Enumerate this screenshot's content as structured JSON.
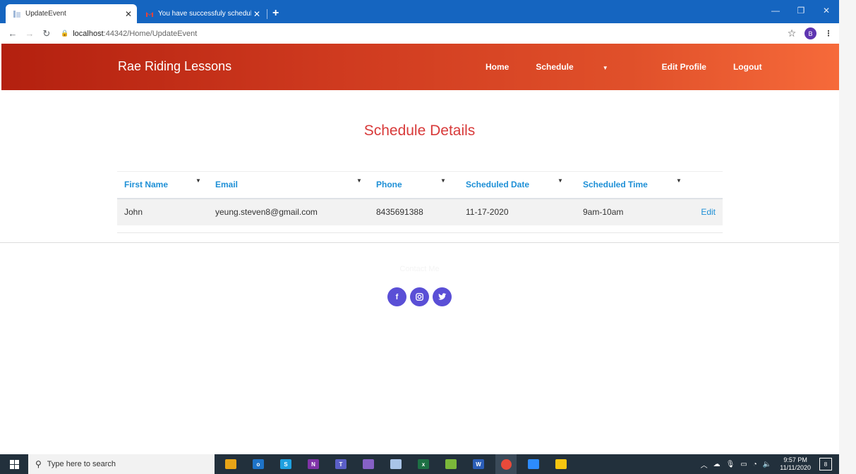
{
  "browser": {
    "tabs": [
      {
        "title": "UpdateEvent",
        "active": true
      },
      {
        "title": "You have successfuly scheduled t",
        "active": false
      }
    ],
    "new_tab_label": "+",
    "url_host": "localhost",
    "url_path": ":44342/Home/UpdateEvent",
    "profile_initial": "B"
  },
  "site": {
    "brand": "Rae Riding Lessons",
    "nav": {
      "home": "Home",
      "schedule": "Schedule",
      "edit_profile": "Edit Profile",
      "logout": "Logout"
    },
    "accent_color": "#d83a3a",
    "link_color": "#1d8fd6"
  },
  "main": {
    "heading": "Schedule Details",
    "table": {
      "columns": [
        "First Name",
        "Email",
        "Phone",
        "Scheduled Date",
        "Scheduled Time"
      ],
      "rows": [
        {
          "first_name": "John",
          "email": "yeung.steven8@gmail.com",
          "phone": "8435691388",
          "date": "11-17-2020",
          "time": "9am-10am",
          "action": "Edit"
        }
      ]
    }
  },
  "footer": {
    "contact_label": "Contact Me",
    "socials": [
      {
        "icon": "facebook-icon",
        "glyph": "f"
      },
      {
        "icon": "instagram-icon",
        "glyph": "◙"
      },
      {
        "icon": "twitter-icon",
        "glyph": "✦"
      }
    ]
  },
  "taskbar": {
    "search_placeholder": "Type here to search",
    "time": "9:57 PM",
    "date": "11/11/2020",
    "notification_count": "8",
    "apps": [
      {
        "name": "file-explorer-icon",
        "label": "",
        "color": "#e8a417"
      },
      {
        "name": "outlook-icon",
        "label": "o",
        "color": "#1e73c8"
      },
      {
        "name": "skype-icon",
        "label": "S",
        "color": "#1ea0e0"
      },
      {
        "name": "onenote-icon",
        "label": "N",
        "color": "#8033a8"
      },
      {
        "name": "teams-icon",
        "label": "T",
        "color": "#5b5fc7"
      },
      {
        "name": "visual-studio-icon",
        "label": "",
        "color": "#8661c5"
      },
      {
        "name": "powershell-icon",
        "label": "",
        "color": "#a9c4e8"
      },
      {
        "name": "excel-icon",
        "label": "x",
        "color": "#1d7044"
      },
      {
        "name": "project-icon",
        "label": "",
        "color": "#7bb83a"
      },
      {
        "name": "word-icon",
        "label": "W",
        "color": "#2b5eb8"
      },
      {
        "name": "chrome-icon",
        "label": "",
        "color": "#e84a3a"
      },
      {
        "name": "zoom-icon",
        "label": "",
        "color": "#2d8cff"
      },
      {
        "name": "sticky-notes-icon",
        "label": "",
        "color": "#f6c510"
      }
    ]
  }
}
